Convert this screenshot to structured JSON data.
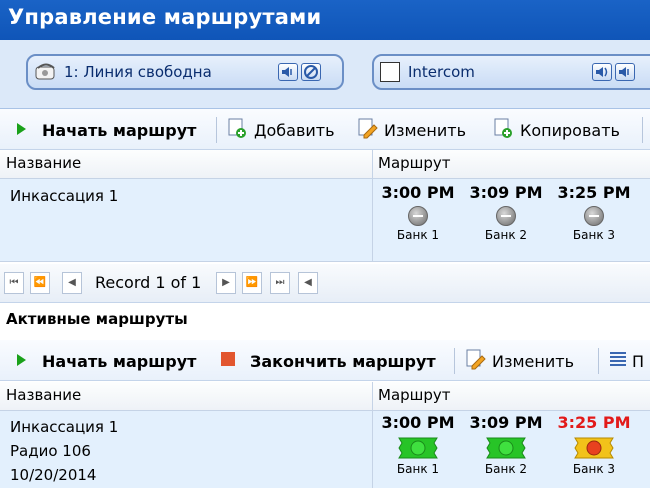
{
  "window": {
    "title": "Управление маршрутами"
  },
  "lines": [
    {
      "label": "1: Линия свободна"
    },
    {
      "label": "Intercom"
    }
  ],
  "toolbar_top": {
    "start": "Начать маршрут",
    "add": "Добавить",
    "edit": "Изменить",
    "copy": "Копировать"
  },
  "grid_top": {
    "col_name": "Название",
    "col_route": "Маршрут",
    "row": {
      "name": "Инкассация 1",
      "stops": [
        {
          "time": "3:00 PM",
          "bank": "Банк 1",
          "status": "grey"
        },
        {
          "time": "3:09 PM",
          "bank": "Банк 2",
          "status": "grey"
        },
        {
          "time": "3:25 PM",
          "bank": "Банк 3",
          "status": "grey"
        }
      ]
    }
  },
  "pager": {
    "text": "Record 1 of 1"
  },
  "active": {
    "title": "Активные маршруты",
    "toolbar": {
      "start": "Начать маршрут",
      "stop": "Закончить маршрут",
      "edit": "Изменить",
      "more": "П"
    },
    "col_name": "Название",
    "col_route": "Маршрут",
    "row": {
      "name": "Инкассация 1",
      "radio": "Радио 106",
      "date": "10/20/2014",
      "stops": [
        {
          "time": "3:00 PM",
          "bank": "Банк 1",
          "status": "green"
        },
        {
          "time": "3:09 PM",
          "bank": "Банк 2",
          "status": "green"
        },
        {
          "time": "3:25 PM",
          "bank": "Банк 3",
          "status": "red"
        }
      ]
    }
  },
  "colors": {
    "title_bar": "#1a63c6",
    "late_time": "#e21a1a",
    "ok": "#27c427",
    "alarm_bg": "#f2c21a"
  }
}
